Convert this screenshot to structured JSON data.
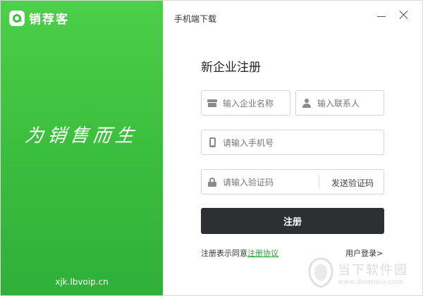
{
  "brand": {
    "name": "销荐客",
    "slogan": "为销售而生",
    "site": "xjk.lbvoip.cn",
    "accent": "#3cc03e"
  },
  "topbar": {
    "mobile_link": "手机端下载",
    "minimize_icon": "minimize-icon",
    "close_icon": "close-icon"
  },
  "form": {
    "title": "新企业注册",
    "company_placeholder": "输入企业名称",
    "contact_placeholder": "输入联系人",
    "phone_placeholder": "请输入手机号",
    "code_placeholder": "请输入验证码",
    "send_code_label": "发送验证码",
    "register_label": "注册",
    "agree_text": "注册表示同意",
    "agreement_link": "注册协议",
    "login_link": "用户登录>",
    "button_color": "#2d2f33"
  },
  "watermark": {
    "cn": "当下软件园",
    "url": "www.downxia.com"
  }
}
